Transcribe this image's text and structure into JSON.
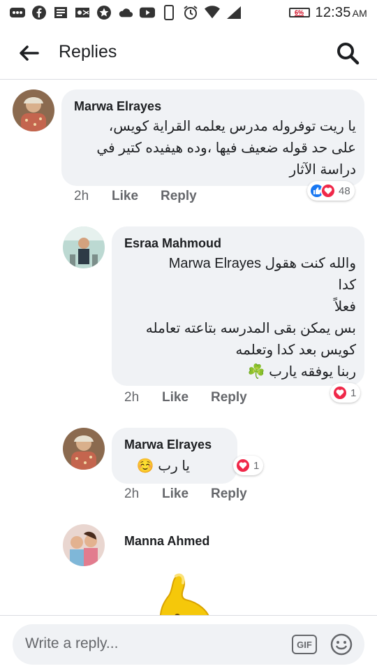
{
  "status_bar": {
    "battery": "6%",
    "time": "12:35",
    "ampm": "AM"
  },
  "header": {
    "title": "Replies"
  },
  "comments": [
    {
      "author": "Marwa Elrayes",
      "text": "يا ريت توفروله مدرس يعلمه القراية كويس،\nعلى حد قوله ضعيف فيها ،وده هيفيده كتير في\nدراسة الآثار",
      "time": "2h",
      "like": "Like",
      "reply": "Reply",
      "reaction_count": "48"
    },
    {
      "author": "Esraa Mahmoud",
      "text": "والله كنت هقول Marwa Elrayes\nكدا\nفعلاً\nبس يمكن بقى المدرسه بتاعته تعامله\nكويس بعد كدا وتعلمه\nربنا يوفقه يارب ☘️",
      "time": "2h",
      "like": "Like",
      "reply": "Reply",
      "reaction_count": "1"
    },
    {
      "author": "Marwa Elrayes",
      "text": "يا رب ☺️",
      "time": "2h",
      "like": "Like",
      "reply": "Reply",
      "reaction_count": "1"
    },
    {
      "author": "Manna Ahmed"
    }
  ],
  "composer": {
    "placeholder": "Write a reply...",
    "gif_label": "GIF"
  },
  "colors": {
    "bubble": "#f0f2f5",
    "like_blue": "#1877f2",
    "love_red": "#f02849"
  }
}
